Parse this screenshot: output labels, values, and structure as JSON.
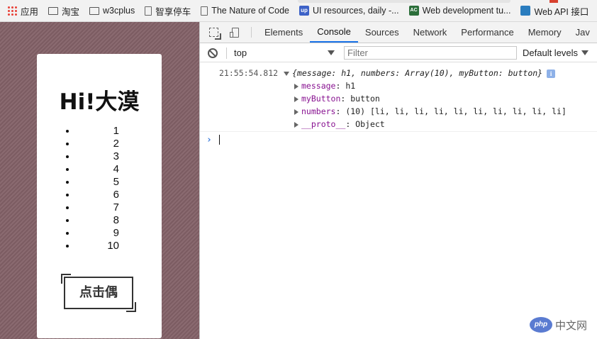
{
  "bookmarks": [
    {
      "label": "应用",
      "icon": "apps-grid-icon"
    },
    {
      "label": "淘宝",
      "icon": "folder-icon"
    },
    {
      "label": "w3cplus",
      "icon": "folder-icon"
    },
    {
      "label": "智享停车",
      "icon": "page-icon"
    },
    {
      "label": "The Nature of Code",
      "icon": "page-icon"
    },
    {
      "label": "UI resources, daily -...",
      "icon": "up-icon"
    },
    {
      "label": "Web development tu...",
      "icon": "ac-icon"
    },
    {
      "label": "Web API 接口",
      "icon": "mdn-icon"
    }
  ],
  "page": {
    "title": "Hi!大漠",
    "numbers": [
      "1",
      "2",
      "3",
      "4",
      "5",
      "6",
      "7",
      "8",
      "9",
      "10"
    ],
    "button_label": "点击偶"
  },
  "devtools": {
    "tabs": [
      "Elements",
      "Console",
      "Sources",
      "Network",
      "Performance",
      "Memory",
      "Jav"
    ],
    "active_tab": "Console",
    "context": "top",
    "filter_placeholder": "Filter",
    "levels_label": "Default levels",
    "log": {
      "timestamp": "21:55:54.812",
      "summary": "{message: h1, numbers: Array(10), myButton: button}",
      "info_badge": "i",
      "props": [
        {
          "key": "message",
          "value": "h1"
        },
        {
          "key": "myButton",
          "value": "button"
        },
        {
          "key": "numbers",
          "value": "(10) [li, li, li, li, li, li, li, li, li, li]"
        },
        {
          "key": "__proto__",
          "value": "Object"
        }
      ]
    },
    "prompt": "›"
  },
  "watermark": {
    "logo": "php",
    "text": "中文网"
  },
  "colors": {
    "accent": "#1a73e8",
    "prop_key": "#881391",
    "stripe": "#8a6a70"
  }
}
